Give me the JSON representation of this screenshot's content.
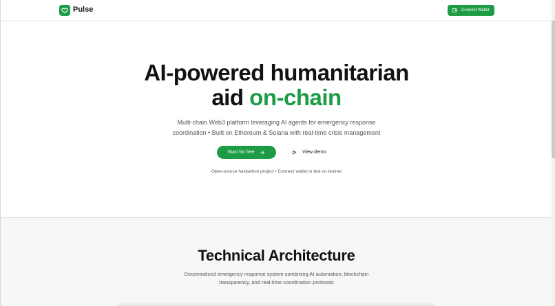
{
  "header": {
    "brand": "Pulse",
    "logo_icon": "heart-icon",
    "connect_label": "Connect Wallet",
    "connect_icon": "wallet-icon"
  },
  "hero": {
    "title_line1": "AI-powered humanitarian",
    "title_line2_plain": "aid",
    "title_line2_accent": "on-chain",
    "subtitle_line1": "Multi-chain Web3 platform leveraging AI agents for emergency response",
    "subtitle_line2": "coordination • Built on Ethereum & Solana with real-time crisis management",
    "start_label": "Start for free",
    "demo_label": "View demo",
    "note": "Open-source hackathon project • Connect wallet to test on testnet"
  },
  "architecture": {
    "title": "Technical Architecture",
    "subtitle_line1": "Decentralized emergency response system combining AI automation, blockchain",
    "subtitle_line2": "transparency, and real-time coordination protocols"
  },
  "colors": {
    "accent": "#1e9b45",
    "text": "#111111",
    "muted": "#555555",
    "section_bg": "#f7f7f7"
  }
}
